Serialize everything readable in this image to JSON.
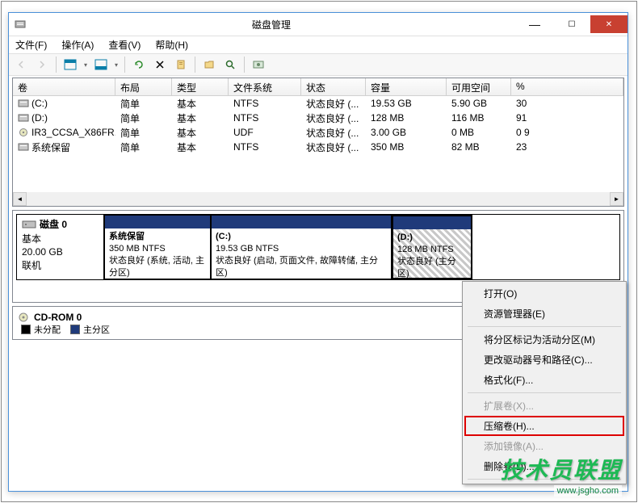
{
  "window": {
    "title": "磁盘管理"
  },
  "menubar": {
    "file": "文件(F)",
    "action": "操作(A)",
    "view": "查看(V)",
    "help": "帮助(H)"
  },
  "table": {
    "headers": {
      "volume": "卷",
      "layout": "布局",
      "type": "类型",
      "filesystem": "文件系统",
      "status": "状态",
      "capacity": "容量",
      "freespace": "可用空间",
      "percent": "%"
    },
    "rows": [
      {
        "vol": "(C:)",
        "layout": "简单",
        "type": "基本",
        "fs": "NTFS",
        "status": "状态良好 (...",
        "capacity": "19.53 GB",
        "free": "5.90 GB",
        "pct": "30"
      },
      {
        "vol": "(D:)",
        "layout": "简单",
        "type": "基本",
        "fs": "NTFS",
        "status": "状态良好 (...",
        "capacity": "128 MB",
        "free": "116 MB",
        "pct": "91"
      },
      {
        "vol": "IR3_CCSA_X86FR...",
        "layout": "简单",
        "type": "基本",
        "fs": "UDF",
        "status": "状态良好 (...",
        "capacity": "3.00 GB",
        "free": "0 MB",
        "pct": "0 9"
      },
      {
        "vol": "系统保留",
        "layout": "简单",
        "type": "基本",
        "fs": "NTFS",
        "status": "状态良好 (...",
        "capacity": "350 MB",
        "free": "82 MB",
        "pct": "23"
      }
    ]
  },
  "disk": {
    "label": "磁盘 0",
    "type": "基本",
    "size": "20.00 GB",
    "status": "联机",
    "partitions": [
      {
        "name": "系统保留",
        "size": "350 MB NTFS",
        "status": "状态良好 (系统, 活动, 主分区)"
      },
      {
        "name": "(C:)",
        "size": "19.53 GB NTFS",
        "status": "状态良好 (启动, 页面文件, 故障转储, 主分区)"
      },
      {
        "name": "(D:)",
        "size": "128 MB NTFS",
        "status": "状态良好 (主分区)"
      }
    ]
  },
  "cdrom": {
    "label": "CD-ROM 0"
  },
  "legend": {
    "unallocated": "未分配",
    "primary": "主分区"
  },
  "context_menu": {
    "open": "打开(O)",
    "explorer": "资源管理器(E)",
    "mark_active": "将分区标记为活动分区(M)",
    "change_drive": "更改驱动器号和路径(C)...",
    "format": "格式化(F)...",
    "extend": "扩展卷(X)...",
    "shrink": "压缩卷(H)...",
    "add_mirror": "添加镜像(A)...",
    "delete": "删除卷(D)..."
  },
  "watermark": {
    "main": "技术员联盟",
    "sub": "www.jsgho.com"
  }
}
